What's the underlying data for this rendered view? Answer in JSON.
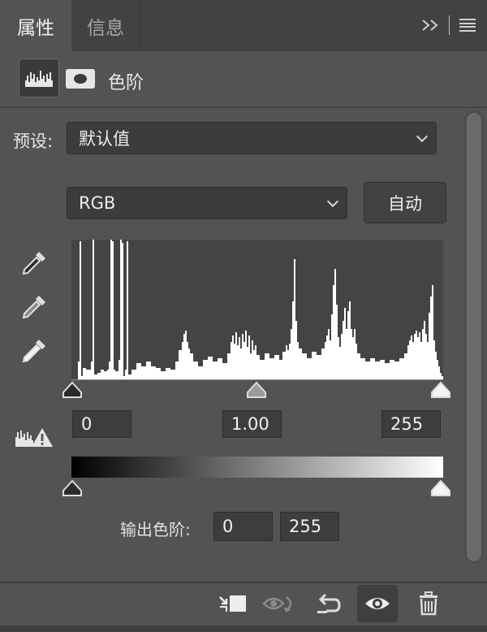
{
  "tabs": [
    {
      "label": "属性",
      "active": true
    },
    {
      "label": "信息",
      "active": false
    }
  ],
  "tabbar": {
    "expand_icon": "double-chevron-right-icon",
    "menu_icon": "hamburger-menu-icon"
  },
  "header": {
    "title": "色阶",
    "adjustment_icon": "levels-histogram-icon",
    "mask_icon": "layer-mask-icon"
  },
  "preset": {
    "label": "预设:",
    "value": "默认值"
  },
  "channel": {
    "value": "RGB"
  },
  "auto_button": {
    "label": "自动"
  },
  "eyedroppers": [
    "black-point-eyedropper-icon",
    "gray-point-eyedropper-icon",
    "white-point-eyedropper-icon"
  ],
  "input_levels": {
    "shadows": "0",
    "midtones": "1.00",
    "highlights": "255"
  },
  "output_levels": {
    "label": "输出色阶:",
    "shadows": "0",
    "highlights": "255"
  },
  "toolbar": {
    "buttons": [
      "clip-to-layer-icon",
      "view-previous-state-icon",
      "reset-icon",
      "visibility-eye-icon",
      "trash-icon"
    ]
  },
  "colors": {
    "panel": "#535353",
    "tabbar": "#424242",
    "field": "#3d3d3d",
    "histogram_bg": "#444444"
  }
}
